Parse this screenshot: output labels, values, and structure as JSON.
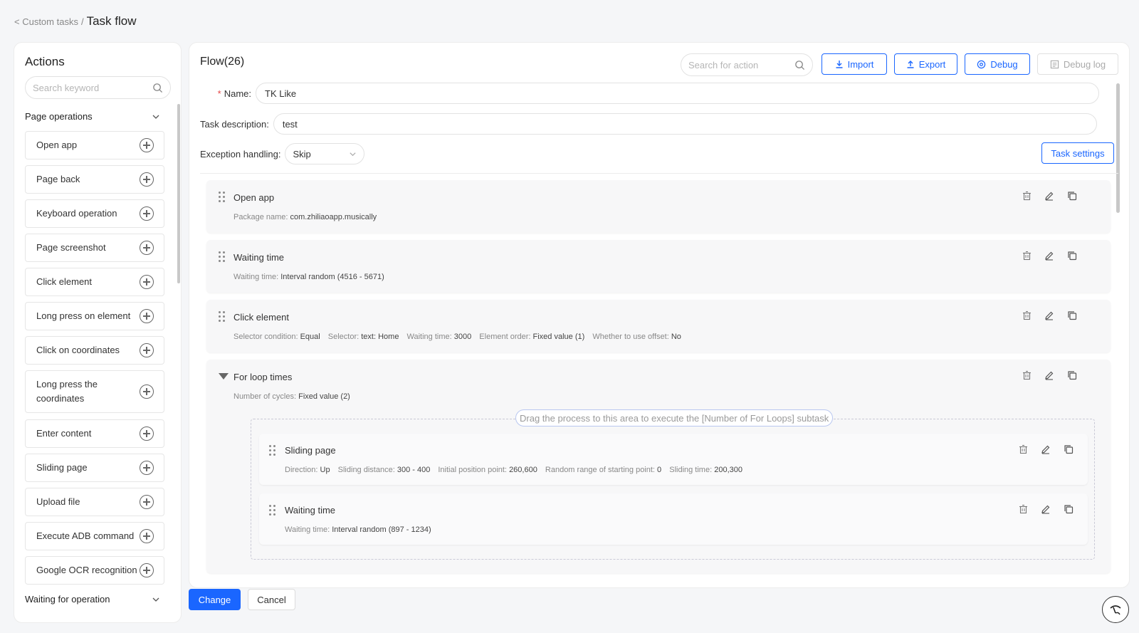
{
  "breadcrumb": {
    "back_label": "< Custom tasks",
    "separator": "/",
    "current": "Task flow"
  },
  "actions_panel": {
    "title": "Actions",
    "search_placeholder": "Search keyword",
    "section_page_operations": "Page operations",
    "items": [
      "Open app",
      "Page back",
      "Keyboard operation",
      "Page screenshot",
      "Click element",
      "Long press on element",
      "Click on coordinates",
      "Long press the coordinates",
      "Enter content",
      "Sliding page",
      "Upload file",
      "Execute ADB command",
      "Google OCR recognition"
    ],
    "section_waiting": "Waiting for operation"
  },
  "flow": {
    "title": "Flow(26)",
    "search_placeholder": "Search for action",
    "import_label": "Import",
    "export_label": "Export",
    "debug_label": "Debug",
    "debug_log_label": "Debug log",
    "name_label": "Name:",
    "name_value": "TK Like",
    "desc_label": "Task description:",
    "desc_value": "test",
    "exception_label": "Exception handling:",
    "exception_value": "Skip",
    "task_settings_label": "Task settings"
  },
  "steps": {
    "open_app": {
      "title": "Open app",
      "k1": "Package name:",
      "v1": "com.zhiliaoapp.musically"
    },
    "wait1": {
      "title": "Waiting time",
      "k1": "Waiting time:",
      "v1": "Interval random (4516 - 5671)"
    },
    "click": {
      "title": "Click element",
      "k1": "Selector condition:",
      "v1": "Equal",
      "k2": "Selector:",
      "v2": "text:",
      "v2b": "Home",
      "k3": "Waiting time:",
      "v3": "3000",
      "k4": "Element order:",
      "v4": "Fixed value (1)",
      "k5": "Whether to use offset:",
      "v5": "No"
    },
    "loop": {
      "title": "For loop times",
      "k1": "Number of cycles:",
      "v1": "Fixed value (2)",
      "drop_hint": "Drag the process to this area to execute the [Number of For Loops] subtask"
    },
    "slide": {
      "title": "Sliding page",
      "k1": "Direction:",
      "v1": "Up",
      "k2": "Sliding distance:",
      "v2": "300 - 400",
      "k3": "Initial position point:",
      "v3": "260,600",
      "k4": "Random range of starting point:",
      "v4": "0",
      "k5": "Sliding time:",
      "v5": "200,300"
    },
    "wait2": {
      "title": "Waiting time",
      "k1": "Waiting time:",
      "v1": "Interval random (897 - 1234)"
    }
  },
  "footer": {
    "change_label": "Change",
    "cancel_label": "Cancel"
  },
  "colors": {
    "primary": "#1a66ff",
    "required": "#e54545"
  }
}
